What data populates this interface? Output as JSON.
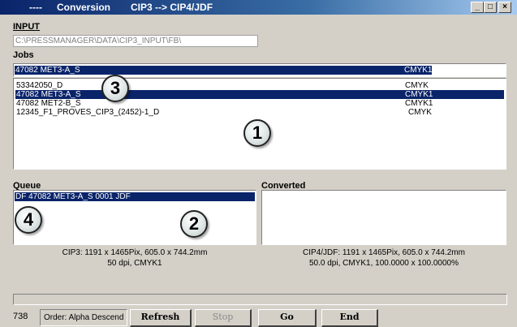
{
  "window": {
    "title_prefix": "----",
    "title_main": "Conversion",
    "title_sub": "CIP3 --> CIP4/JDF",
    "min_label": "_",
    "max_label": "□",
    "close_label": "×"
  },
  "input": {
    "label": "INPUT",
    "path": "C:\\PRESSMANAGER\\DATA\\CIP3_INPUT\\FB\\"
  },
  "jobs": {
    "label": "Jobs",
    "selected": {
      "name": "47082 MET3-A_S",
      "color": "CMYK1"
    },
    "rows": [
      {
        "name": "53342050_D",
        "color": "CMYK"
      },
      {
        "name": "47082 MET3-A_S",
        "color": "CMYK1"
      },
      {
        "name": "47082 MET2-B_S",
        "color": "CMYK1"
      },
      {
        "name": "12345_F1_PROVES_CIP3_(2452)-1_D",
        "color": "CMYK"
      }
    ],
    "selected_row_index": 1
  },
  "queue": {
    "label": "Queue",
    "items": [
      "DF 47082 MET3-A_S 0001 JDF"
    ],
    "info_line1": "CIP3: 1191 x 1465Pix, 605.0 x 744.2mm",
    "info_line2": "50 dpi, CMYK1"
  },
  "converted": {
    "label": "Converted",
    "items": [],
    "info_line1": "CIP4/JDF: 1191 x 1465Pix, 605.0 x 744.2mm",
    "info_line2": "50.0 dpi, CMYK1, 100.0000 x 100.0000%"
  },
  "callouts": [
    "1",
    "2",
    "3",
    "4"
  ],
  "progress": {
    "value": 0
  },
  "status": {
    "count": "738",
    "order": "Order: Alpha Descend"
  },
  "buttons": {
    "refresh": "Refresh",
    "stop": "Stop",
    "go": "Go",
    "end": "End"
  },
  "colors": {
    "title_start": "#0a246a",
    "title_end": "#a6caf0",
    "selection": "#0a246a",
    "face": "#d4d0c8"
  }
}
